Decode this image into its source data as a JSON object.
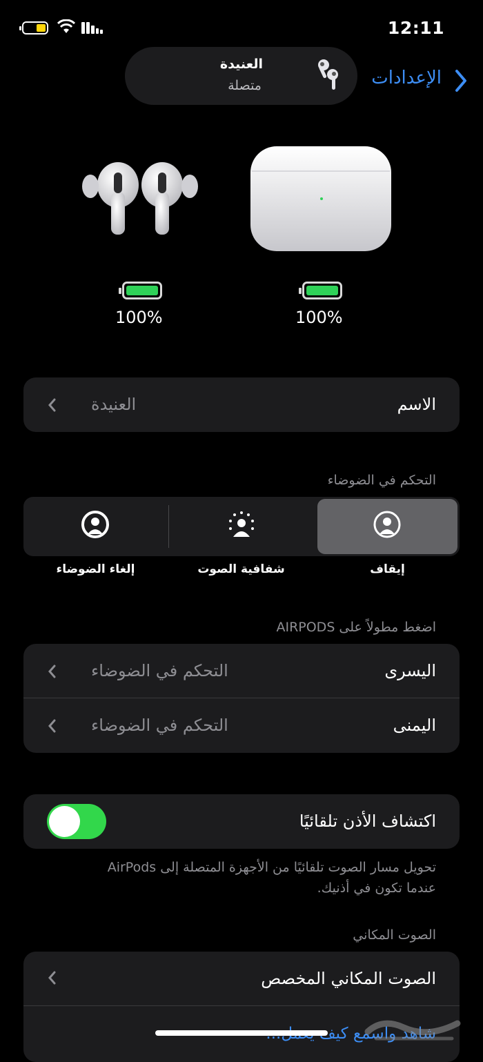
{
  "status_bar": {
    "time": "12:11",
    "battery_level": 0.35
  },
  "nav": {
    "back_label": "الإعدادات"
  },
  "device_pill": {
    "name": "العنيدة",
    "status": "متصلة"
  },
  "batteries": {
    "earbuds": {
      "percent_label": "100%",
      "level": 1.0
    },
    "case": {
      "percent_label": "100%",
      "level": 1.0
    }
  },
  "name_row": {
    "title": "الاسم",
    "value": "العنيدة"
  },
  "noise_control": {
    "section_label": "التحكم في الضوضاء",
    "options": [
      {
        "label": "إيقاف",
        "selected": true
      },
      {
        "label": "شفافية الصوت",
        "selected": false
      },
      {
        "label": "إلغاء الضوضاء",
        "selected": false
      }
    ]
  },
  "press_hold": {
    "section_label": "اضغط مطولاً على AIRPODS",
    "rows": [
      {
        "title": "اليسرى",
        "value": "التحكم في الضوضاء"
      },
      {
        "title": "اليمنى",
        "value": "التحكم في الضوضاء"
      }
    ]
  },
  "ear_detection": {
    "title": "اكتشاف الأذن تلقائيًا",
    "enabled": true,
    "footnote_line1": "تحويل مسار الصوت تلقائيًا من الأجهزة المتصلة إلى AirPods",
    "footnote_line2": "عندما تكون في أذنيك."
  },
  "spatial_audio": {
    "section_label": "الصوت المكاني",
    "row_title": "الصوت المكاني المخصص",
    "link_text": "شاهد واسمع كيف يعمل..."
  },
  "colors": {
    "accent": "#3d8ef5",
    "toggle_on": "#32d74b",
    "battery_green": "#2fd158",
    "background": "#000000",
    "cell": "#1c1c1e"
  }
}
